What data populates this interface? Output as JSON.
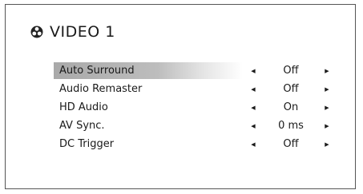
{
  "header": {
    "icon": "dolby-tri-icon",
    "title": "VIDEO 1"
  },
  "menu": {
    "items": [
      {
        "label": "Auto Surround",
        "value": "Off",
        "selected": true
      },
      {
        "label": "Audio Remaster",
        "value": "Off",
        "selected": false
      },
      {
        "label": "HD Audio",
        "value": "On",
        "selected": false
      },
      {
        "label": "AV Sync.",
        "value": "0 ms",
        "selected": false
      },
      {
        "label": "DC Trigger",
        "value": "Off",
        "selected": false
      }
    ],
    "left_arrow": "◀",
    "right_arrow": "▶"
  },
  "colors": {
    "selected_bg": "#a9a9a9",
    "border": "#555555"
  }
}
